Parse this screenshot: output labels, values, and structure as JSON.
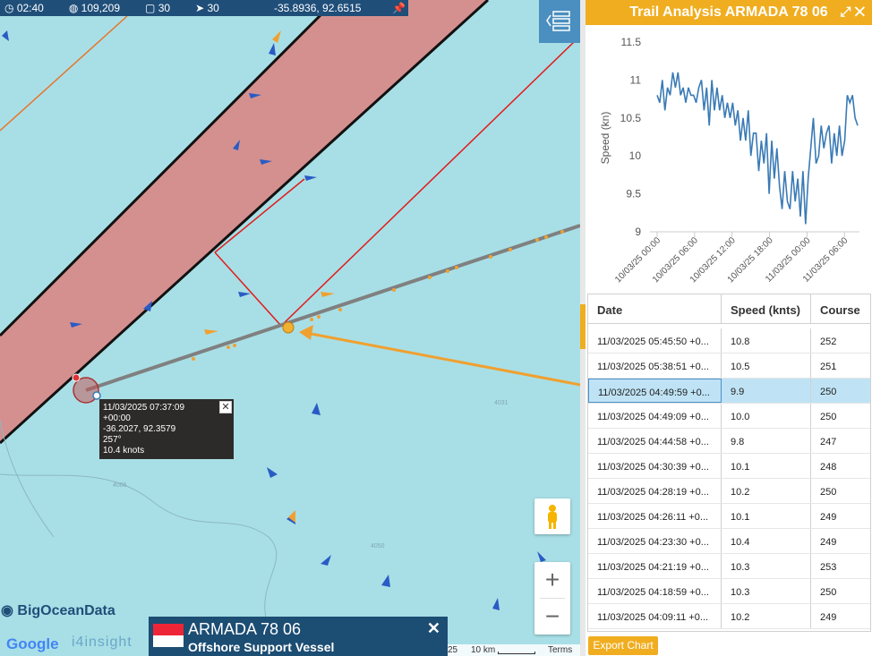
{
  "topbar": {
    "time": "02:40",
    "count_a": "109,209",
    "count_b": "30",
    "count_c": "30",
    "coords": "-35.8936, 92.6515"
  },
  "tooltip": {
    "line1": "11/03/2025 07:37:09",
    "line2": "+00:00",
    "line3": "-36.2027, 92.3579",
    "line4": "257°",
    "line5": "10.4 knots"
  },
  "map": {
    "brand": "BigOceanData",
    "google": "Google",
    "partner": "i4insight",
    "scale_label": "10 km",
    "scale_prefix": "25",
    "terms": "Terms",
    "depth_labels": [
      "4031",
      "4006",
      "4050"
    ]
  },
  "vessel": {
    "name": "ARMADA 78 06",
    "type": "Offshore Support Vessel",
    "close": "✕"
  },
  "panel": {
    "title": "Trail Analysis ARMADA 78 06",
    "export_label": "Export Chart"
  },
  "chart_data": {
    "type": "line",
    "ylabel": "Speed (kn)",
    "ylim": [
      9,
      11.5
    ],
    "yticks": [
      9,
      9.5,
      10,
      10.5,
      11,
      11.5
    ],
    "xticks": [
      "10/03/25 00:00",
      "10/03/25 06:00",
      "10/03/25 12:00",
      "10/03/25 18:00",
      "11/03/25 00:00",
      "11/03/25 06:00"
    ],
    "series": [
      {
        "values": [
          10.8,
          10.7,
          11.0,
          10.6,
          10.9,
          10.8,
          11.1,
          10.9,
          11.1,
          10.8,
          10.9,
          10.7,
          10.9,
          10.8,
          10.8,
          10.7,
          10.9,
          11.0,
          10.6,
          10.9,
          10.4,
          11.0,
          10.6,
          10.9,
          10.6,
          10.8,
          10.5,
          10.7,
          10.5,
          10.7,
          10.4,
          10.6,
          10.2,
          10.5,
          10.2,
          10.6,
          10.0,
          10.3,
          10.3,
          9.8,
          10.2,
          9.9,
          10.3,
          9.5,
          10.2,
          9.7,
          10.1,
          9.6,
          9.3,
          9.8,
          9.4,
          9.3,
          9.8,
          9.4,
          9.7,
          9.2,
          9.8,
          9.1,
          9.7,
          10.1,
          10.5,
          9.9,
          10.0,
          10.4,
          10.1,
          10.3,
          10.4,
          9.9,
          10.3,
          10.0,
          10.4,
          10.0,
          10.2,
          10.8,
          10.7,
          10.8,
          10.5,
          10.4
        ]
      }
    ]
  },
  "table": {
    "headers": [
      "Date",
      "Speed (knts)",
      "Course"
    ],
    "rows": [
      [
        "11/03/2025 05:45:50 +0...",
        "10.8",
        "252"
      ],
      [
        "11/03/2025 05:38:51 +0...",
        "10.5",
        "251"
      ],
      [
        "11/03/2025 04:49:59 +0...",
        "9.9",
        "250"
      ],
      [
        "11/03/2025 04:49:09 +0...",
        "10.0",
        "250"
      ],
      [
        "11/03/2025 04:44:58 +0...",
        "9.8",
        "247"
      ],
      [
        "11/03/2025 04:30:39 +0...",
        "10.1",
        "248"
      ],
      [
        "11/03/2025 04:28:19 +0...",
        "10.2",
        "250"
      ],
      [
        "11/03/2025 04:26:11 +0...",
        "10.1",
        "249"
      ],
      [
        "11/03/2025 04:23:30 +0...",
        "10.4",
        "249"
      ],
      [
        "11/03/2025 04:21:19 +0...",
        "10.3",
        "253"
      ],
      [
        "11/03/2025 04:18:59 +0...",
        "10.3",
        "250"
      ],
      [
        "11/03/2025 04:09:11 +0...",
        "10.2",
        "249"
      ]
    ],
    "selected_index": 2
  },
  "colors": {
    "accent": "#f0ad1f",
    "topbar": "#1f4e79",
    "sea": "#a8dfe6",
    "zone": "#d4908f",
    "line": "#3a7ab5"
  }
}
